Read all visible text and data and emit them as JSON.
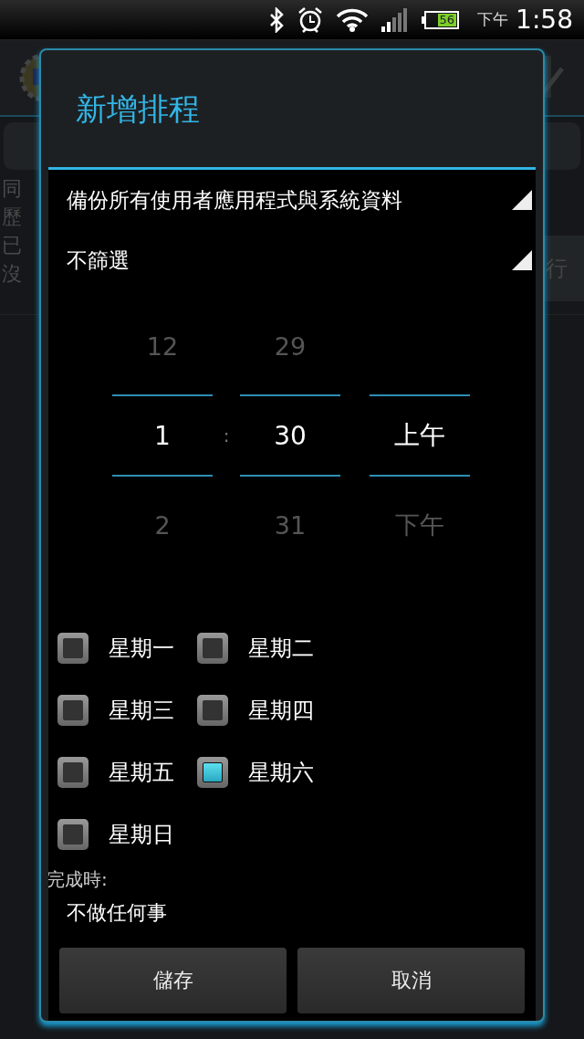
{
  "status_bar": {
    "battery": "56",
    "ampm": "下午",
    "time": "1:58"
  },
  "background_lines": [
    "同",
    "歷",
    "已",
    "沒"
  ],
  "background_button": "行",
  "dialog": {
    "title": "新增排程",
    "spinners": [
      "備份所有使用者應用程式與系統資料",
      "不篩選"
    ],
    "time_picker": {
      "separator": ":",
      "columns": [
        {
          "above": "12",
          "value": "1",
          "below": "2"
        },
        {
          "above": "29",
          "value": "30",
          "below": "31"
        },
        {
          "value": "上午",
          "below": "下午"
        }
      ]
    },
    "days": [
      {
        "label": "星期一",
        "checked": false
      },
      {
        "label": "星期二",
        "checked": false
      },
      {
        "label": "星期三",
        "checked": false
      },
      {
        "label": "星期四",
        "checked": false
      },
      {
        "label": "星期五",
        "checked": false
      },
      {
        "label": "星期六",
        "checked": true
      },
      {
        "label": "星期日",
        "checked": false
      }
    ],
    "on_finish_label": "完成時:",
    "on_finish_value": "不做任何事",
    "buttons": [
      "儲存",
      "取消"
    ]
  }
}
